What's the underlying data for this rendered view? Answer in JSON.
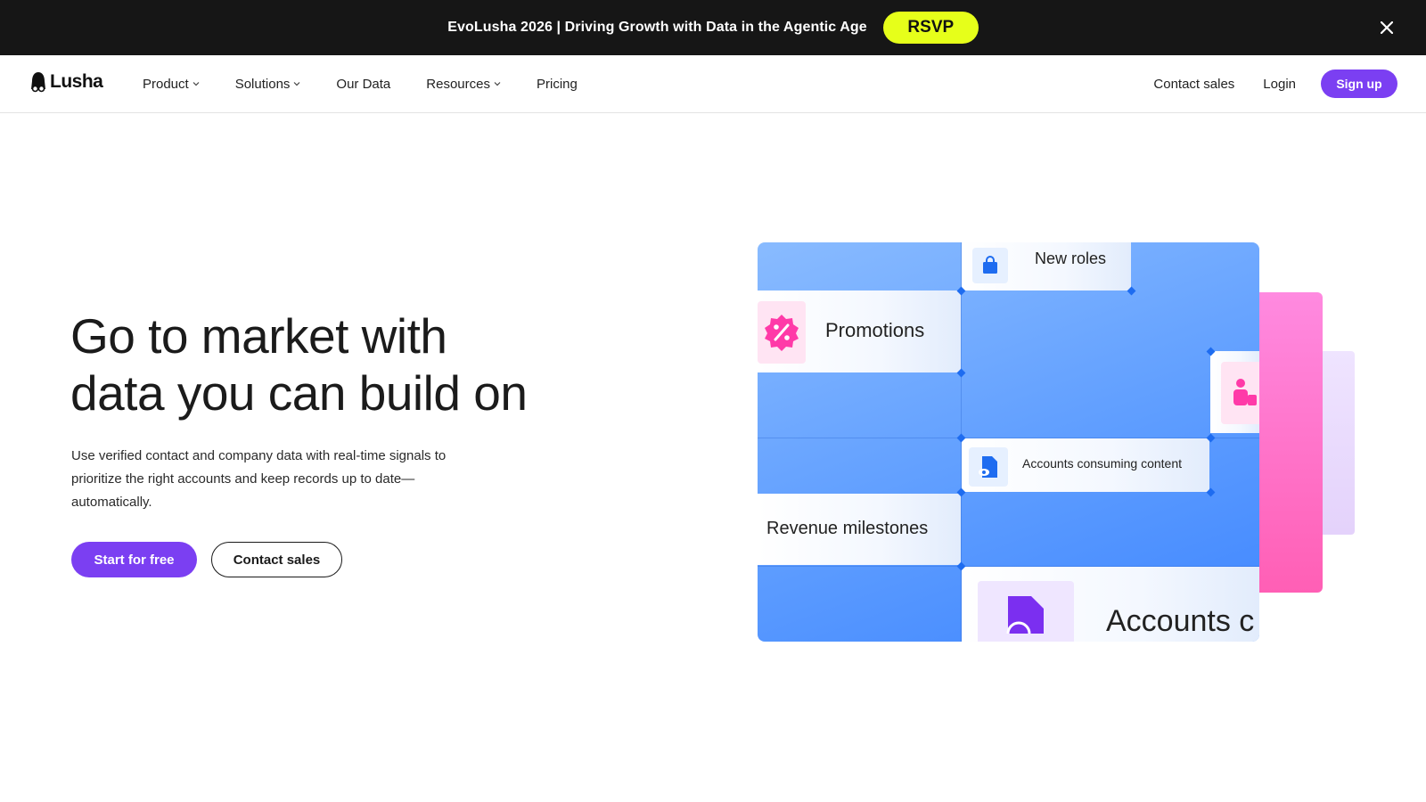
{
  "announcement": {
    "text": "EvoLusha 2026 | Driving Growth with Data in the Agentic Age",
    "rsvp_label": "RSVP"
  },
  "nav": {
    "logo": "Lusha",
    "items": [
      {
        "label": "Product",
        "dropdown": true
      },
      {
        "label": "Solutions",
        "dropdown": true
      },
      {
        "label": "Our Data",
        "dropdown": false
      },
      {
        "label": "Resources",
        "dropdown": true
      },
      {
        "label": "Pricing",
        "dropdown": false
      }
    ],
    "contact_sales": "Contact sales",
    "login": "Login",
    "signup": "Sign up"
  },
  "hero": {
    "title_line1": "Go to market with",
    "title_line2": "data you can build on",
    "subtitle": "Use verified contact and company data with real-time signals to prioritize the right accounts and keep records up to date—automatically.",
    "cta_primary": "Start for free",
    "cta_secondary": "Contact sales"
  },
  "illustration": {
    "new_roles": "New roles",
    "promotions": "Promotions",
    "accounts_consuming_content": "Accounts consuming content",
    "revenue_milestones": "Revenue milestones",
    "accounts_partial": "Accounts c"
  },
  "colors": {
    "accent": "#7b3ff2",
    "rsvp": "#e6ff1a",
    "announcement_bg": "#161616",
    "grid_blue": "#5e9dff",
    "pink": "#ff5fb5"
  }
}
